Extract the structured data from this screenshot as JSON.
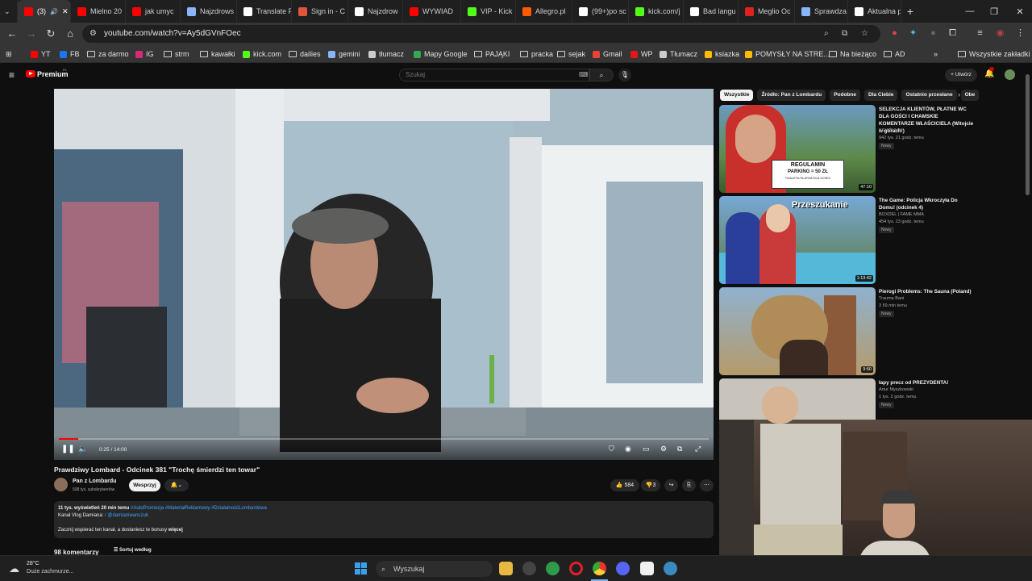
{
  "browser": {
    "tabs": [
      {
        "label": "(3)",
        "color": "#ff0000",
        "active": true
      },
      {
        "label": "Mielno 20",
        "color": "#ff0000"
      },
      {
        "label": "jak umyc",
        "color": "#ff0000"
      },
      {
        "label": "Najzdrows",
        "color": "#8ab4f8"
      },
      {
        "label": "Translate F",
        "color": "#ffffff"
      },
      {
        "label": "Sign in - C",
        "color": "#e0553a"
      },
      {
        "label": "Najzdrow",
        "color": "#ffffff"
      },
      {
        "label": "WYWIAD",
        "color": "#ff0000"
      },
      {
        "label": "VIP - Kick",
        "color": "#53fc18"
      },
      {
        "label": "Allegro.pl",
        "color": "#ff5a00"
      },
      {
        "label": "(99+)po sc",
        "color": "#ffffff"
      },
      {
        "label": "kick.com/j",
        "color": "#53fc18"
      },
      {
        "label": "Bad langu",
        "color": "#ffffff"
      },
      {
        "label": "Meglio Oc",
        "color": "#e02020"
      },
      {
        "label": "Sprawdza",
        "color": "#8ab4f8"
      },
      {
        "label": "Aktualna p",
        "color": "#ffffff"
      }
    ],
    "url": "youtube.com/watch?v=Ay5dGVnFOec",
    "bookmarks": [
      {
        "label": "YT",
        "icon": "youtube-icon"
      },
      {
        "label": "FB",
        "icon": "facebook-icon"
      },
      {
        "label": "za darmo",
        "icon": "folder-icon"
      },
      {
        "label": "IG",
        "icon": "instagram-icon"
      },
      {
        "label": "strm",
        "icon": "folder-icon"
      },
      {
        "label": "kawałki",
        "icon": "folder-icon"
      },
      {
        "label": "kick.com",
        "icon": "kick-icon"
      },
      {
        "label": "dailies",
        "icon": "folder-icon"
      },
      {
        "label": "gemini",
        "icon": "gemini-icon"
      },
      {
        "label": "tłumacz",
        "icon": "translate-icon"
      },
      {
        "label": "Mapy Google",
        "icon": "maps-icon"
      },
      {
        "label": "PAJĄKI",
        "icon": "folder-icon"
      },
      {
        "label": "pracka",
        "icon": "folder-icon"
      },
      {
        "label": "sejak",
        "icon": "folder-icon"
      },
      {
        "label": "Gmail",
        "icon": "gmail-icon"
      },
      {
        "label": "WP",
        "icon": "wp-icon"
      },
      {
        "label": "Tłumacz",
        "icon": "translate-icon"
      },
      {
        "label": "ksiazka",
        "icon": "grid-icon"
      },
      {
        "label": "POMYSŁY NA STRE...",
        "icon": "grid-icon"
      },
      {
        "label": "Na bieżąco",
        "icon": "folder-icon"
      },
      {
        "label": "AD",
        "icon": "folder-icon"
      }
    ],
    "all_bookmarks": "Wszystkie zakładki"
  },
  "youtube": {
    "logo": "Premium",
    "logo_sup": "PL",
    "search_placeholder": "Szukaj",
    "create_label": "Utwórz",
    "player": {
      "time": "0:25 / 14:00",
      "progress": 0.03
    },
    "video_title": "Prawdziwy Lombard - Odcinek 381 \"Trochę śmierdzi ten towar\"",
    "channel": {
      "name": "Pan z Lombardu",
      "subs": "508 tys. subskrybentów",
      "support_label": "Wesprzyj"
    },
    "likes": "584",
    "dislikes": "3",
    "description": {
      "stats": "11 tys. wyświetleń  20 min temu",
      "hashtags": "#AutoPromocja #MateriałReklamowy #DziałalnośćLombardowa",
      "line2_label": "Kanał Vlog Damiana:",
      "line2_link": "/ @damianiwanczuk",
      "line3": "Zacznij wspierać ten kanał, a dostaniesz te bonusy",
      "more": "więcej"
    },
    "comments_count": "98 komentarzy",
    "sort_label": "Sortuj według",
    "chips": [
      "Wszystkie",
      "Źródło: Pan z Lombardu",
      "Podobne",
      "Dla Ciebie",
      "Ostatnio przesłane",
      "Obe"
    ],
    "recommendations": [
      {
        "title": "SELEKCJA KLIENTÓW, PŁATNE WC DLA GOŚCI I CHAMSKIE KOMENTARZE WŁAŚCICIELA (Witojcie w górach!)",
        "channel": "KSIĄŻULO",
        "meta": "942 tys.  21 godz. temu",
        "badge": "Nowy",
        "duration": "47:10",
        "thumb_text1": "REGULAMIN",
        "thumb_text2": "PARKING = 50 ZŁ",
        "thumb_text3": "TOALETA PŁATNA DLA GOŚCI"
      },
      {
        "title": "The Game: Policja Wkroczyła Do Domu! (odcinek 4)",
        "channel": "BOXDEL | FAME MMA",
        "meta": "454 tys.  23 godz. temu",
        "badge": "Nowy",
        "duration": "1:13:42",
        "thumb_text1": "Przeszukanie"
      },
      {
        "title": "Pierogi Problems: The Sauna (Poland)",
        "channel": "Trauma Bani",
        "meta": "3  59 min temu",
        "badge": "Nowy",
        "duration": "9:50"
      },
      {
        "title": "łapy precz od PREZYDENTA!",
        "channel": "Artur Myszkowski",
        "meta": "1 tys.  2 godz. temu",
        "badge": "Nowy"
      }
    ]
  },
  "taskbar": {
    "weather_temp": "28°C",
    "weather_desc": "Duże zachmurze...",
    "search_placeholder": "Wyszukaj"
  }
}
